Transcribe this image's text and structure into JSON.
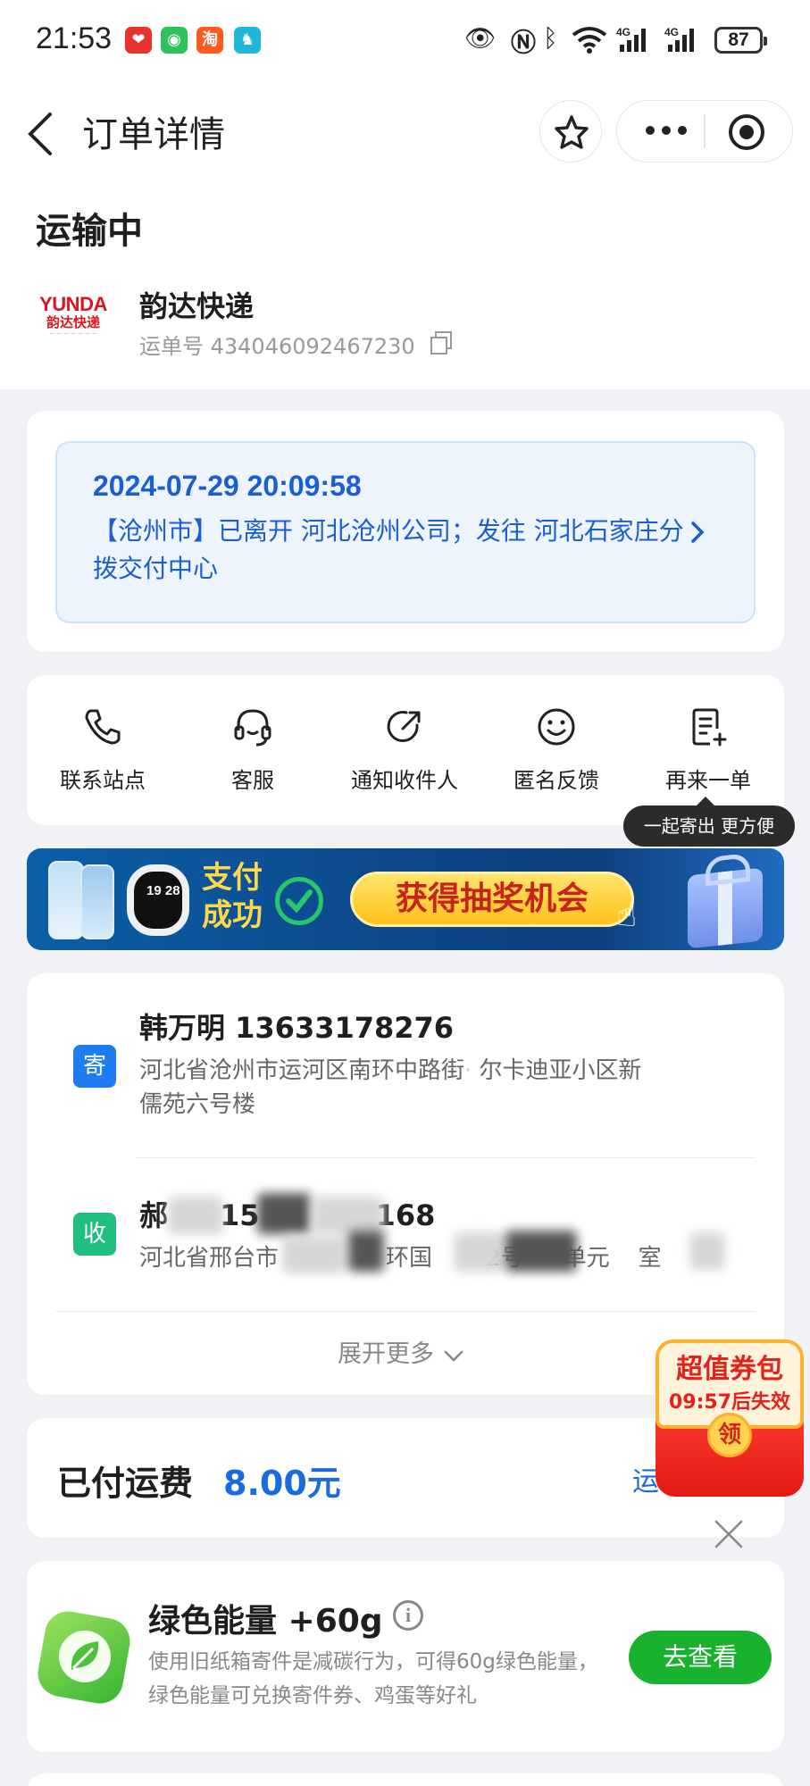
{
  "status_bar": {
    "time": "21:53",
    "battery": "87",
    "app_icons": [
      "app-red-icon",
      "wechat-icon",
      "taobao-icon",
      "camel-icon"
    ],
    "sys_icons": [
      "eye-icon",
      "nfc-icon",
      "bluetooth-icon",
      "wifi-icon",
      "signal-4g-icon",
      "signal-4g-icon"
    ]
  },
  "header": {
    "title": "订单详情"
  },
  "order": {
    "state": "运输中",
    "courier_logo_en": "YUNDA",
    "courier_logo_cn": "韵达快递",
    "courier_name": "韵达快递",
    "waybill_label": "运单号 434046092467230"
  },
  "tracking": {
    "datetime": "2024-07-29 20:09:58",
    "text": "【沧州市】已离开 河北沧州公司；发往 河北石家庄分拨交付中心"
  },
  "actions": [
    {
      "label": "联系站点",
      "icon": "phone-icon"
    },
    {
      "label": "客服",
      "icon": "headset-icon"
    },
    {
      "label": "通知收件人",
      "icon": "share-arrow-icon"
    },
    {
      "label": "匿名反馈",
      "icon": "smile-icon"
    },
    {
      "label": "再来一单",
      "icon": "reorder-icon"
    }
  ],
  "tooltip": "一起寄出 更方便",
  "banner": {
    "watch_time": "19 28",
    "pay_line1": "支付",
    "pay_line2": "成功",
    "cta": "获得抽奖机会"
  },
  "sender": {
    "badge": "寄",
    "name": "韩万明 13633178276",
    "address": "河北省沧州市运河区南环中路街道阿尔卡迪亚小区新儒苑六号楼",
    "address_line1": "河北省沧州市运河区南环中路街",
    "address_line1b": "尔卡迪亚小区新",
    "address_line2": "儒苑六号楼"
  },
  "receiver": {
    "badge": "收",
    "name_part1": "郝",
    "name_part2": "15",
    "name_part3": "168",
    "addr_part1": "河北省邢台市",
    "addr_part2": "环国",
    "addr_part3": "2号",
    "addr_part4": "单元",
    "addr_part5": "室"
  },
  "expand_more": "展开更多",
  "coupon": {
    "title": "超值券包",
    "countdown": "09:57后失效",
    "claim": "领"
  },
  "fee": {
    "label": "已付运费",
    "value": "8.00元",
    "link": "运"
  },
  "energy": {
    "title": "绿色能量 +60g",
    "info": "i",
    "desc": "使用旧纸箱寄件是减碳行为，可得60g绿色能量，绿色能量可兑换寄件券、鸡蛋等好礼",
    "button": "去查看"
  },
  "colors": {
    "accent_blue": "#1a6ae0",
    "green": "#19b22e",
    "sender_badge": "#1f7cf0",
    "receiver_badge": "#1fbf7f"
  }
}
